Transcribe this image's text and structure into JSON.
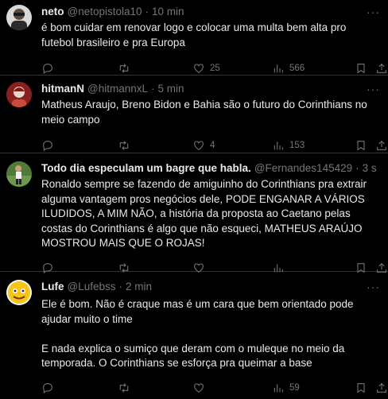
{
  "tweets": [
    {
      "name": "neto",
      "handle": "@netopistola10",
      "dot": "·",
      "time": "10 min",
      "text": "é bom cuidar em renovar logo e colocar uma multa bem alta pro futebol brasileiro e pra Europa",
      "likes": "25",
      "views": "566"
    },
    {
      "name": "hitmanN",
      "handle": "@hitmannxL",
      "dot": "·",
      "time": "5 min",
      "text": "Matheus Araujo, Breno Bidon e Bahia são o futuro do Corinthians no meio campo",
      "likes": "4",
      "views": "153"
    },
    {
      "name": "Todo dia especulam um bagre que habla.",
      "handle": "@Fernandes145429",
      "dot": "·",
      "time": "3 s",
      "text": "Ronaldo sempre se fazendo de amiguinho do Corinthians pra extrair alguma vantagem pros negócios dele, PODE ENGANAR A VÁRIOS ILUDIDOS, A MIM NÃO, a história da proposta ao Caetano pelas costas do Corinthians é algo que não esqueci, MATHEUS ARAÚJO MOSTROU MAIS QUE O ROJAS!",
      "likes": "",
      "views": ""
    },
    {
      "name": "Lufe",
      "handle": "@Lufebss",
      "dot": "·",
      "time": "2 min",
      "text": "Ele é bom. Não é craque mas é um cara que bem orientado pode ajudar muito o time\n\nE nada explica o sumiço que deram com o muleque no meio da temporada. O Corinthians se esforça pra queimar a base",
      "likes": "",
      "views": "59"
    }
  ],
  "more_label": "···",
  "icons": {
    "reply": "reply-icon",
    "retweet": "retweet-icon",
    "like": "heart-icon",
    "views": "views-icon",
    "bookmark": "bookmark-icon",
    "share": "share-icon"
  }
}
